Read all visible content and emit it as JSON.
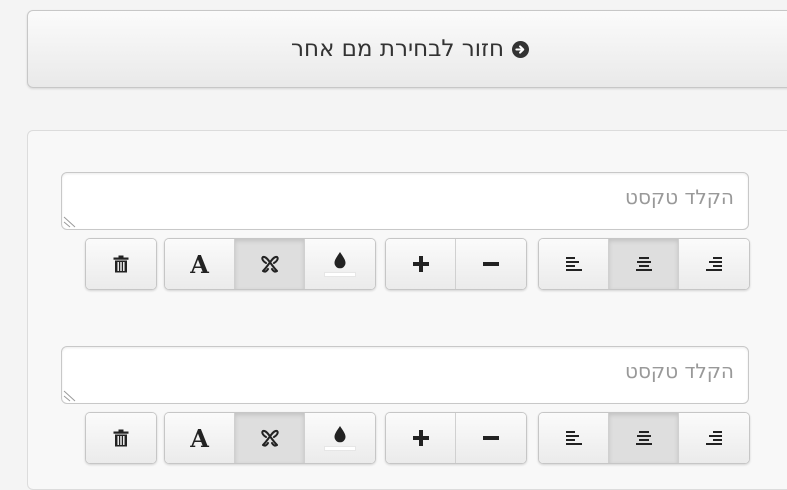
{
  "back_button": {
    "label": "חזור לבחירת מם אחר",
    "icon": "circle-arrow-right-icon"
  },
  "text_blocks": [
    {
      "placeholder": "הקלד טקסט",
      "value": "",
      "toolbar": {
        "delete": {
          "icon": "trash-icon",
          "active": false
        },
        "style_group": [
          {
            "name": "font",
            "icon": "font-icon",
            "glyph": "A",
            "active": false
          },
          {
            "name": "outline",
            "icon": "outline-icon",
            "active": true
          },
          {
            "name": "color",
            "icon": "drop-icon",
            "active": false,
            "color": "#ffffff"
          }
        ],
        "size_group": [
          {
            "name": "increase",
            "icon": "plus-icon",
            "active": false
          },
          {
            "name": "decrease",
            "icon": "minus-icon",
            "active": false
          }
        ],
        "align_group": [
          {
            "name": "align-left",
            "icon": "align-left-icon",
            "active": false
          },
          {
            "name": "align-center",
            "icon": "align-center-icon",
            "active": true
          },
          {
            "name": "align-right",
            "icon": "align-right-icon",
            "active": false
          }
        ]
      }
    },
    {
      "placeholder": "הקלד טקסט",
      "value": "",
      "toolbar": {
        "delete": {
          "icon": "trash-icon",
          "active": false
        },
        "style_group": [
          {
            "name": "font",
            "icon": "font-icon",
            "glyph": "A",
            "active": false
          },
          {
            "name": "outline",
            "icon": "outline-icon",
            "active": true
          },
          {
            "name": "color",
            "icon": "drop-icon",
            "active": false,
            "color": "#ffffff"
          }
        ],
        "size_group": [
          {
            "name": "increase",
            "icon": "plus-icon",
            "active": false
          },
          {
            "name": "decrease",
            "icon": "minus-icon",
            "active": false
          }
        ],
        "align_group": [
          {
            "name": "align-left",
            "icon": "align-left-icon",
            "active": false
          },
          {
            "name": "align-center",
            "icon": "align-center-icon",
            "active": true
          },
          {
            "name": "align-right",
            "icon": "align-right-icon",
            "active": false
          }
        ]
      }
    }
  ]
}
